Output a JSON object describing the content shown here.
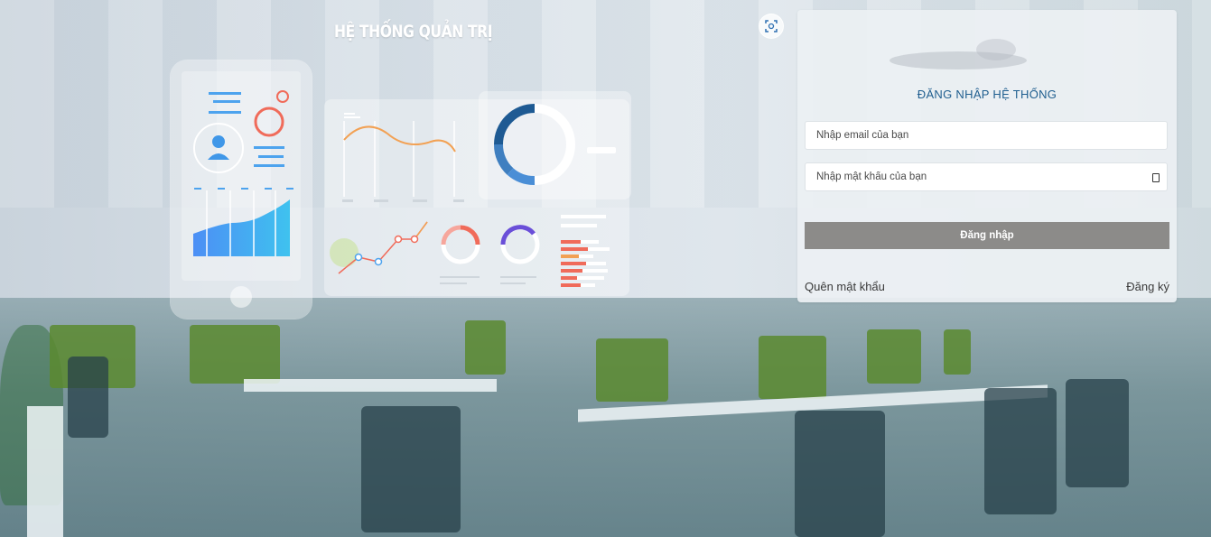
{
  "header": {
    "title": "HỆ THỐNG QUẢN TRỊ"
  },
  "login": {
    "heading": "ĐĂNG NHẬP HỆ THỐNG",
    "email_placeholder": "Nhập email của bạn",
    "email_value": "",
    "password_placeholder": "Nhập mật khẩu của bạn",
    "password_value": "",
    "submit_label": "Đăng nhập",
    "forgot_label": "Quên mật khẩu",
    "register_label": "Đăng ký"
  },
  "icons": {
    "scan": "scan-icon",
    "password_toggle": "eye-icon",
    "logo": "logo-icon"
  },
  "colors": {
    "heading": "#1f5e8f",
    "button_bg": "#8c8b89",
    "card_bg": "#eceff3"
  }
}
